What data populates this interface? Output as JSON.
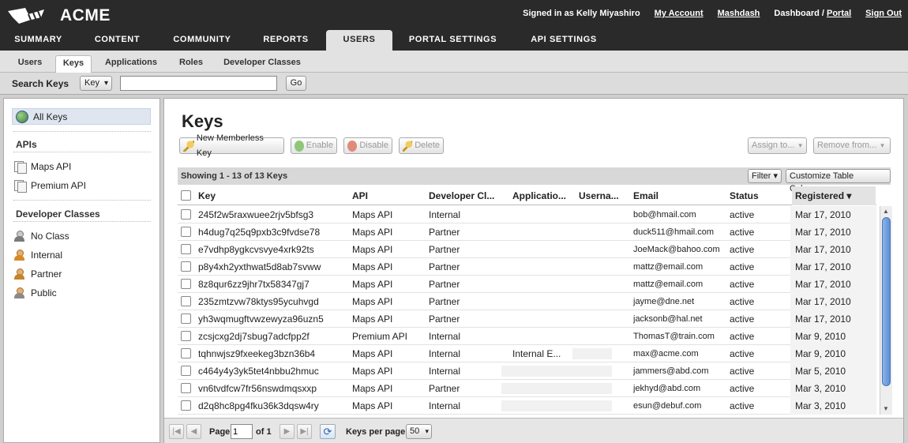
{
  "brand": {
    "name": "ACME"
  },
  "topnav": {
    "signed_in": "Signed in as Kelly Miyashiro",
    "my_account": "My Account",
    "mashdash": "Mashdash",
    "dashboard": "Dashboard /",
    "portal": "Portal",
    "sign_out": "Sign Out"
  },
  "main_tabs": [
    "SUMMARY",
    "CONTENT",
    "COMMUNITY",
    "REPORTS",
    "USERS",
    "PORTAL SETTINGS",
    "API SETTINGS"
  ],
  "main_tab_active": "USERS",
  "sub_tabs": [
    "Users",
    "Keys",
    "Applications",
    "Roles",
    "Developer Classes"
  ],
  "sub_tab_active": "Keys",
  "search": {
    "label": "Search Keys",
    "select_value": "Key",
    "input_value": "",
    "go_label": "Go"
  },
  "sidebar": {
    "all_keys": "All Keys",
    "apis_heading": "APIs",
    "apis": [
      "Maps API",
      "Premium API"
    ],
    "classes_heading": "Developer Classes",
    "classes": [
      "No Class",
      "Internal",
      "Partner",
      "Public"
    ]
  },
  "content": {
    "title": "Keys",
    "toolbar": {
      "new_memberless": "New Memberless Key",
      "enable": "Enable",
      "disable": "Disable",
      "delete": "Delete",
      "assign_to": "Assign to...",
      "remove_from": "Remove from..."
    },
    "showing": "Showing 1 - 13 of 13 Keys",
    "filter": "Filter",
    "customize": "Customize Table Columns",
    "columns": {
      "key": "Key",
      "api": "API",
      "devclass": "Developer Cl...",
      "application": "Applicatio...",
      "username": "Userna...",
      "email": "Email",
      "status": "Status",
      "registered": "Registered"
    },
    "rows": [
      {
        "key": "245f2w5raxwuee2rjv5bfsg3",
        "api": "Maps API",
        "devclass": "Internal",
        "application": "",
        "email": "bob@hmail.com",
        "status": "active",
        "registered": "Mar 17, 2010"
      },
      {
        "key": "h4dug7q25q9pxb3c9fvdse78",
        "api": "Maps API",
        "devclass": "Partner",
        "application": "",
        "email": "duck511@hmail.com",
        "status": "active",
        "registered": "Mar 17, 2010"
      },
      {
        "key": "e7vdhp8ygkcvsvye4xrk92ts",
        "api": "Maps API",
        "devclass": "Partner",
        "application": "",
        "email": "JoeMack@bahoo.com",
        "status": "active",
        "registered": "Mar 17, 2010"
      },
      {
        "key": "p8y4xh2yxthwat5d8ab7svww",
        "api": "Maps API",
        "devclass": "Partner",
        "application": "",
        "email": "mattz@email.com",
        "status": "active",
        "registered": "Mar 17, 2010"
      },
      {
        "key": "8z8qur6zz9jhr7tx58347gj7",
        "api": "Maps API",
        "devclass": "Partner",
        "application": "",
        "email": "mattz@email.com",
        "status": "active",
        "registered": "Mar 17, 2010"
      },
      {
        "key": "235zmtzvw78ktys95ycuhvgd",
        "api": "Maps API",
        "devclass": "Partner",
        "application": "",
        "email": "jayme@dne.net",
        "status": "active",
        "registered": "Mar 17, 2010"
      },
      {
        "key": "yh3wqmugftvwzewyza96uzn5",
        "api": "Maps API",
        "devclass": "Partner",
        "application": "",
        "email": "jacksonb@hal.net",
        "status": "active",
        "registered": "Mar 17, 2010"
      },
      {
        "key": "zcsjcxg2dj7sbug7adcfpp2f",
        "api": "Premium API",
        "devclass": "Internal",
        "application": "",
        "email": "ThomasT@train.com",
        "status": "active",
        "registered": "Mar 9, 2010"
      },
      {
        "key": "tqhnwjsz9fxeekeg3bzn36b4",
        "api": "Maps API",
        "devclass": "Internal",
        "application": "Internal E...",
        "email": "max@acme.com",
        "status": "active",
        "registered": "Mar 9, 2010"
      },
      {
        "key": "c464y4y3yk5tet4nbbu2hmuc",
        "api": "Maps API",
        "devclass": "Internal",
        "application": "",
        "email": "jammers@abd.com",
        "status": "active",
        "registered": "Mar 5, 2010"
      },
      {
        "key": "vn6tvdfcw7fr56nswdmqsxxp",
        "api": "Maps API",
        "devclass": "Partner",
        "application": "",
        "email": "jekhyd@abd.com",
        "status": "active",
        "registered": "Mar 3, 2010"
      },
      {
        "key": "d2q8hc8pg4fku36k3dqsw4ry",
        "api": "Maps API",
        "devclass": "Internal",
        "application": "",
        "email": "esun@debuf.com",
        "status": "active",
        "registered": "Mar 3, 2010"
      }
    ],
    "pager": {
      "page_label": "Page",
      "page_value": "1",
      "of_label": "of 1",
      "per_page_label": "Keys per page",
      "per_page_value": "50"
    }
  }
}
